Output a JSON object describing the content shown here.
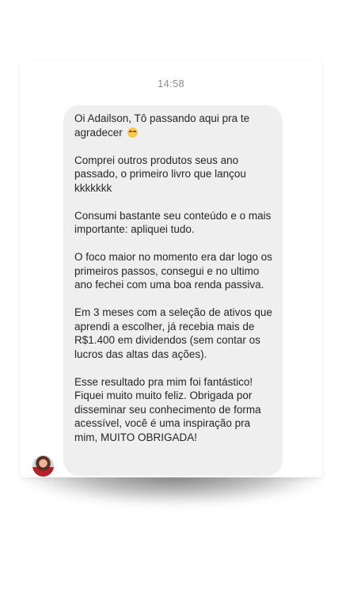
{
  "chat": {
    "timestamp": "14:58",
    "message": {
      "paragraphs": [
        "Oi Adailson, Tô passando aqui pra te agradecer",
        "Comprei outros produtos seus ano passado, o primeiro livro que lançou kkkkkkk",
        "Consumi bastante seu conteúdo e o mais importante: apliquei tudo.",
        "O foco maior no momento era dar logo os primeiros passos, consegui e no ultimo ano fechei com uma boa renda passiva.",
        "Em 3 meses com a seleção de ativos que aprendi a escolher, já recebia mais de R$1.400 em dividendos (sem contar os lucros das altas das ações).",
        "Esse resultado pra mim foi fantástico! Fiquei muito muito feliz. Obrigada por disseminar seu conhecimento de forma acessível, você é uma inspiração pra mim, MUITO OBRIGADA!"
      ],
      "emoji_icon": "smiling-face-emoji"
    },
    "sender_avatar_icon": "sender-avatar",
    "colors": {
      "bubble": "#efefef",
      "text": "#262626",
      "timestamp": "#8e8e8e"
    }
  }
}
